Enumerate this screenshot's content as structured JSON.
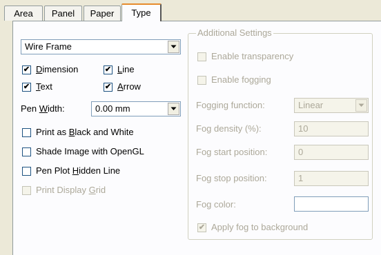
{
  "tabs": [
    "Area",
    "Panel",
    "Paper",
    "Type"
  ],
  "style_combo": {
    "value": "Wire Frame"
  },
  "options": {
    "dimension": {
      "label_pre": "",
      "label_u": "D",
      "label_post": "imension",
      "checked": true
    },
    "line": {
      "label_pre": "",
      "label_u": "L",
      "label_post": "ine",
      "checked": true
    },
    "text": {
      "label_pre": "",
      "label_u": "T",
      "label_post": "ext",
      "checked": true
    },
    "arrow": {
      "label_pre": "",
      "label_u": "A",
      "label_post": "rrow",
      "checked": true
    }
  },
  "pen_width": {
    "label_pre": "Pen ",
    "label_u": "W",
    "label_post": "idth:",
    "value": "0.00 mm"
  },
  "print_options": {
    "black_white": {
      "label_pre": "Print as ",
      "label_u": "B",
      "label_post": "lack and White",
      "checked": false
    },
    "opengl": {
      "label": "Shade Image with OpenGL",
      "checked": false
    },
    "hidden_line": {
      "label_pre": "Pen Plot ",
      "label_u": "H",
      "label_post": "idden Line",
      "checked": false
    },
    "display_grid": {
      "label_pre": "Print Display ",
      "label_u": "G",
      "label_post": "rid",
      "checked": false
    }
  },
  "additional": {
    "title": "Additional Settings",
    "enable_transparency": "Enable transparency",
    "enable_fogging": "Enable fogging",
    "fog_function_label": "Fogging function:",
    "fog_function_value": "Linear",
    "fog_density_label": "Fog density (%):",
    "fog_density_value": "10",
    "fog_start_label": "Fog start position:",
    "fog_start_value": "0",
    "fog_stop_label": "Fog stop position:",
    "fog_stop_value": "1",
    "fog_color_label": "Fog color:",
    "apply_fog_label": "Apply fog to background",
    "apply_fog_checked": true
  },
  "icons": {
    "dropdown": "chevron-down-icon",
    "check": "check-icon"
  },
  "check_glyph": "✔"
}
